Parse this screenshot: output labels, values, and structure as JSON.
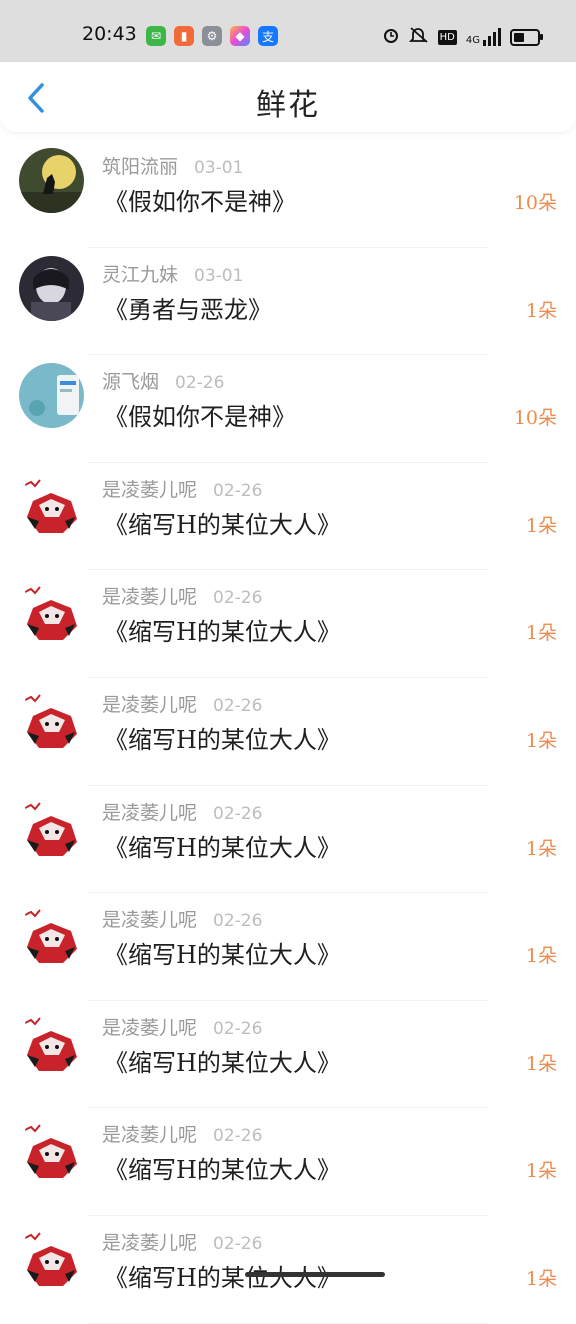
{
  "status_bar": {
    "time": "20:43",
    "network": "4G",
    "hd": "HD",
    "battery_level": 0.45,
    "notification_icons": [
      "wechat-icon",
      "reader-icon",
      "settings-icon",
      "gallery-icon",
      "alipay-icon"
    ],
    "system_icons": [
      "alarm-icon",
      "mute-icon",
      "hd-icon",
      "signal-icon",
      "battery-icon"
    ]
  },
  "header": {
    "title": "鲜花",
    "back_icon": "chevron-left-icon"
  },
  "colors": {
    "accent_blue": "#2f8fe0",
    "count_orange": "#ef8b4c",
    "status_bg": "#dedede"
  },
  "items": [
    {
      "user": "筑阳流丽",
      "date": "03-01",
      "book": "《假如你不是神》",
      "count": "10朵",
      "avatar": "moon-wolf"
    },
    {
      "user": "灵江九妹",
      "date": "03-01",
      "book": "《勇者与恶龙》",
      "count": "1朵",
      "avatar": "dark-figure"
    },
    {
      "user": "源飞烟",
      "date": "02-26",
      "book": "《假如你不是神》",
      "count": "10朵",
      "avatar": "payment-screen"
    },
    {
      "user": "是凌萎儿呢",
      "date": "02-26",
      "book": "《缩写H的某位大人》",
      "count": "1朵",
      "avatar": "red-character"
    },
    {
      "user": "是凌萎儿呢",
      "date": "02-26",
      "book": "《缩写H的某位大人》",
      "count": "1朵",
      "avatar": "red-character"
    },
    {
      "user": "是凌萎儿呢",
      "date": "02-26",
      "book": "《缩写H的某位大人》",
      "count": "1朵",
      "avatar": "red-character"
    },
    {
      "user": "是凌萎儿呢",
      "date": "02-26",
      "book": "《缩写H的某位大人》",
      "count": "1朵",
      "avatar": "red-character"
    },
    {
      "user": "是凌萎儿呢",
      "date": "02-26",
      "book": "《缩写H的某位大人》",
      "count": "1朵",
      "avatar": "red-character"
    },
    {
      "user": "是凌萎儿呢",
      "date": "02-26",
      "book": "《缩写H的某位大人》",
      "count": "1朵",
      "avatar": "red-character"
    },
    {
      "user": "是凌萎儿呢",
      "date": "02-26",
      "book": "《缩写H的某位大人》",
      "count": "1朵",
      "avatar": "red-character"
    },
    {
      "user": "是凌萎儿呢",
      "date": "02-26",
      "book": "《缩写H的某位大人》",
      "count": "1朵",
      "avatar": "red-character"
    }
  ]
}
